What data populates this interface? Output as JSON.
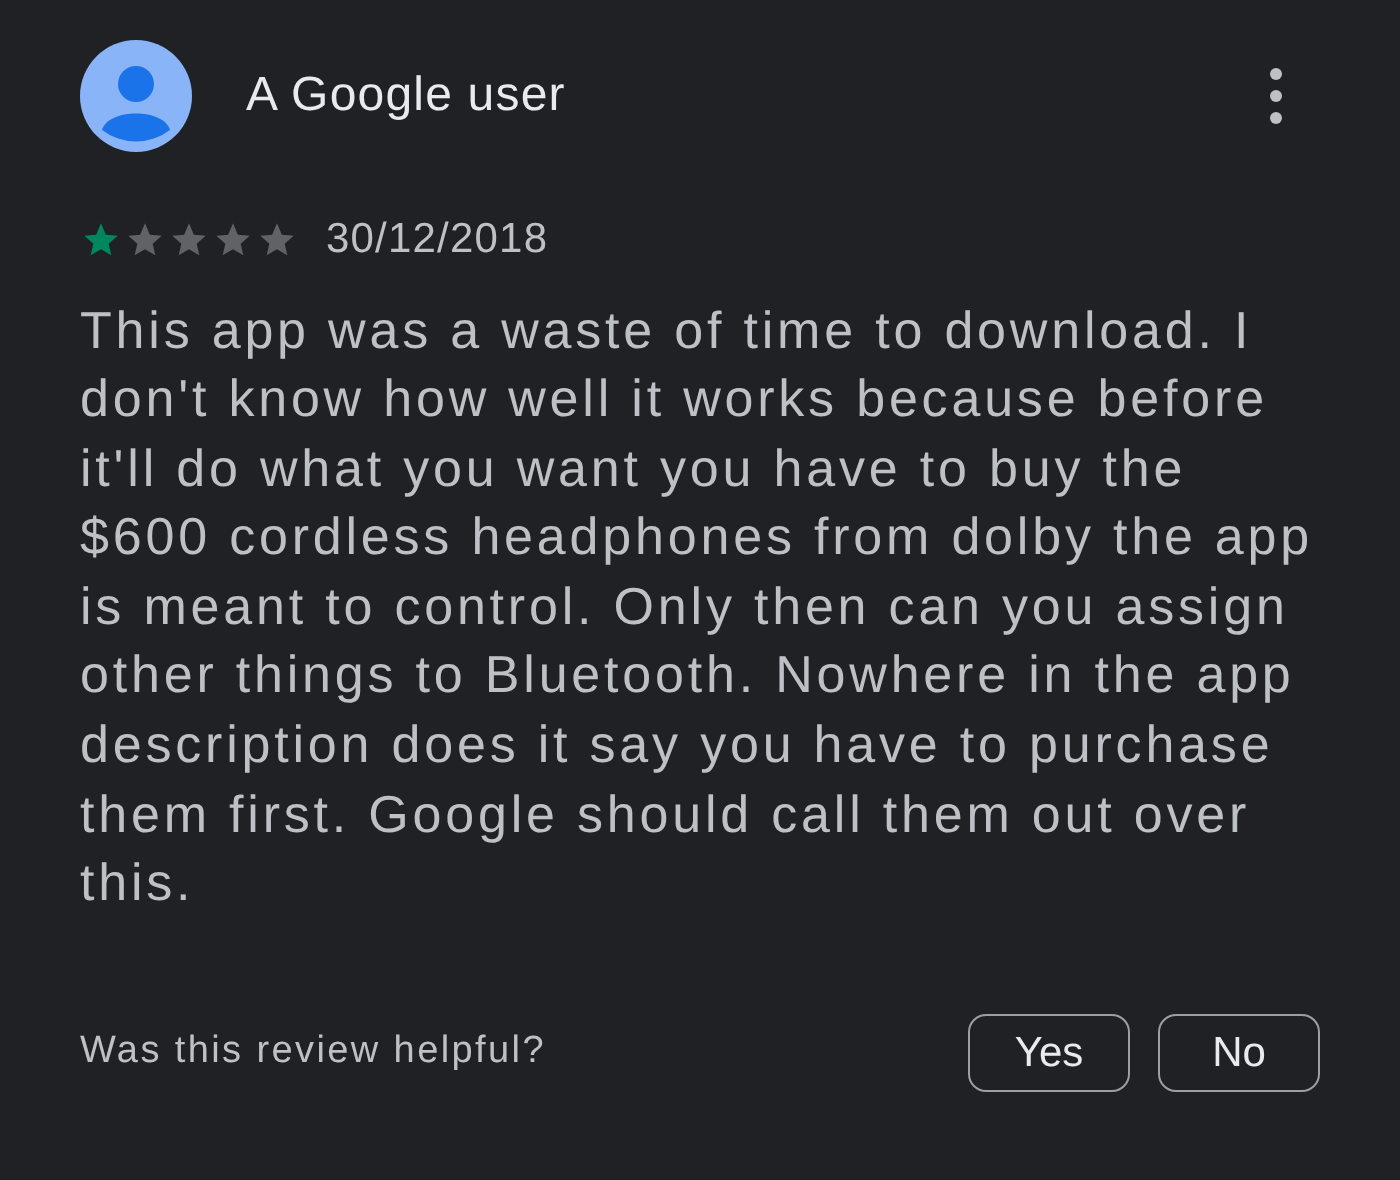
{
  "review": {
    "author": "A Google user",
    "stars": 1,
    "date": "30/12/2018",
    "text": "This app was a waste of time to download. I don't know how well it works because before it'll do what you want you have to buy the $600 cordless headphones from dolby the app is meant to control. Only then can you assign other things to Bluetooth. Nowhere in the app description does it say you have to purchase them first. Google should call them out over this."
  },
  "helpful": {
    "question": "Was this review helpful?",
    "buttons": [
      "Yes",
      "No"
    ]
  }
}
